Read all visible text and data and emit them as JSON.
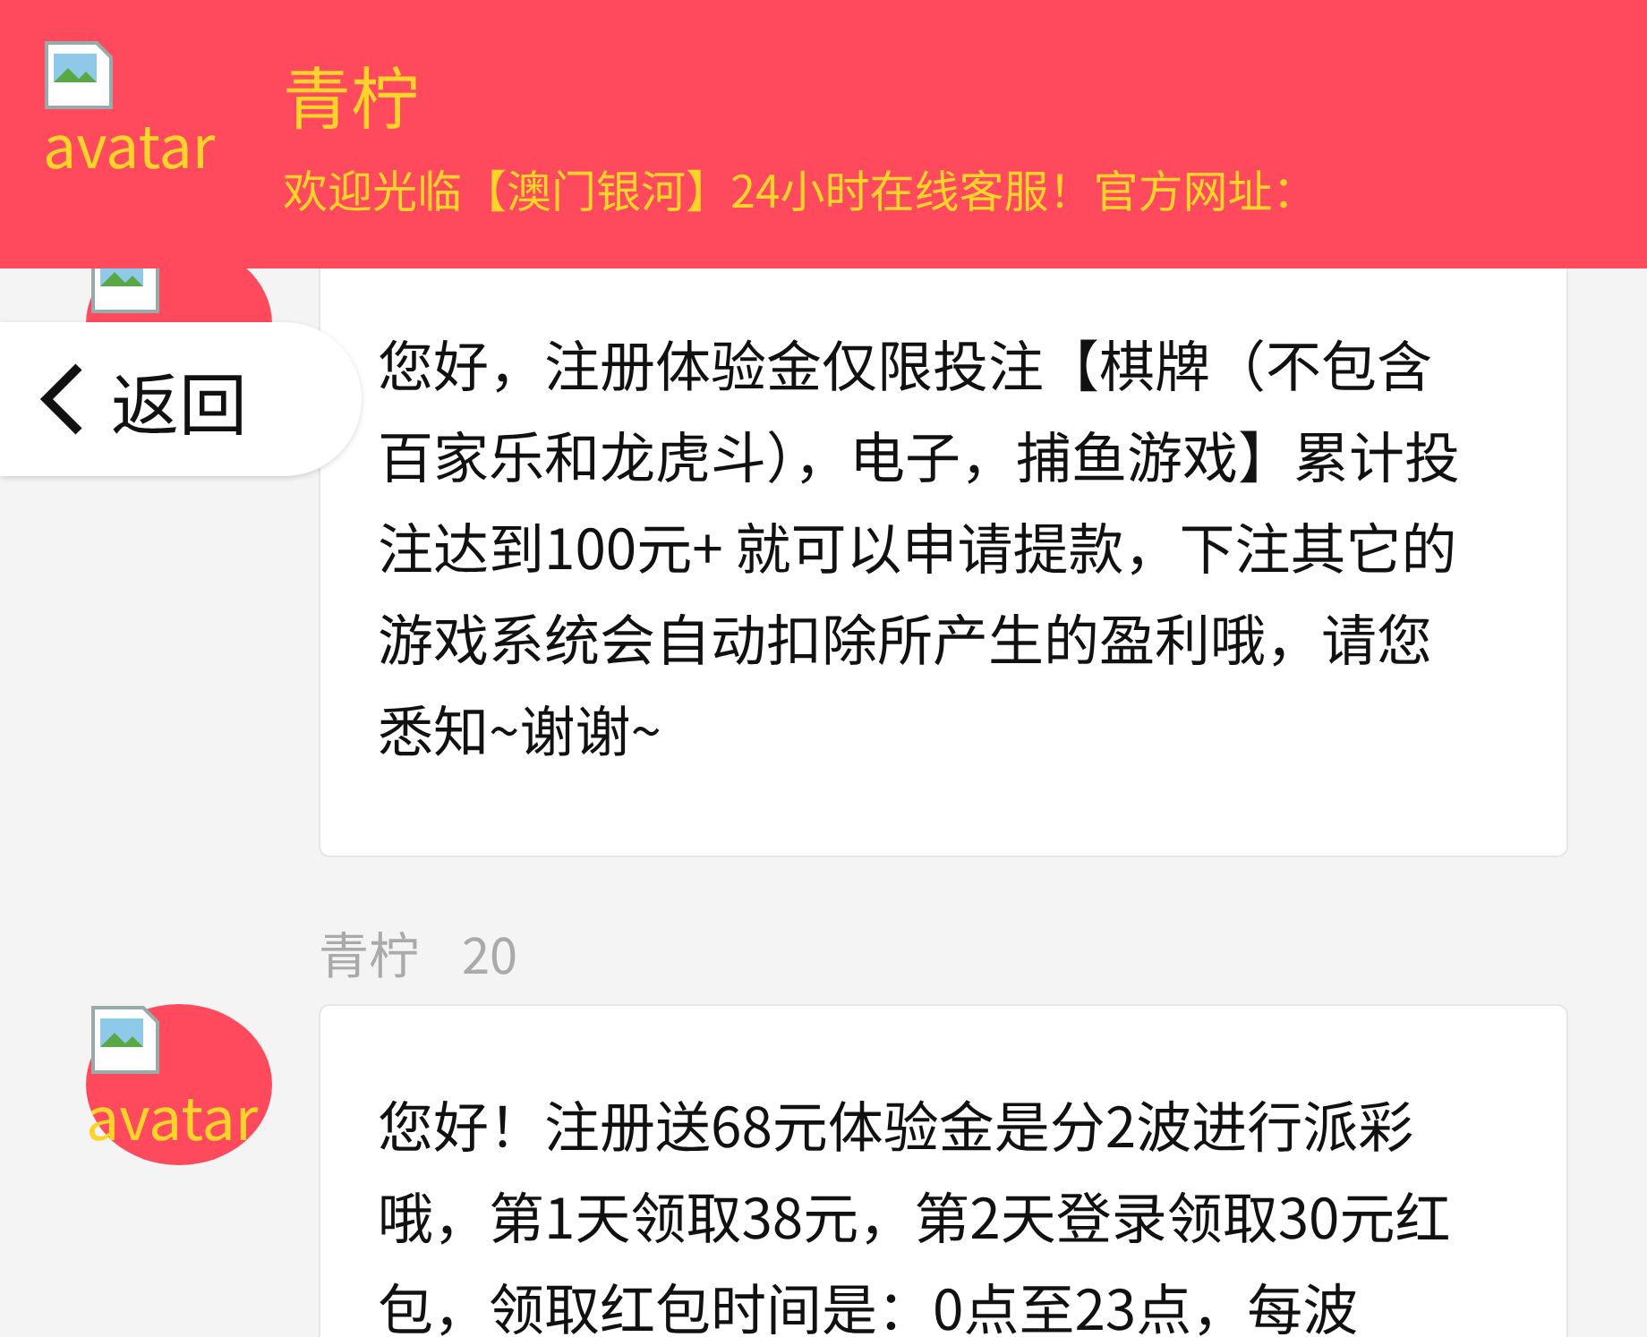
{
  "header": {
    "avatar_alt": "avatar",
    "name": "青柠",
    "marquee": "欢迎光临【澳门银河】24小时在线客服！官方网址："
  },
  "back_button": {
    "label": "返回"
  },
  "messages": [
    {
      "text": "您好，注册体验金仅限投注【棋牌（不包含百家乐和龙虎斗），电子，捕鱼游戏】累计投注达到100元+ 就可以申请提款，下注其它的游戏系统会自动扣除所产生的盈利哦，请您悉知~谢谢~"
    },
    {
      "sender": "青柠",
      "time": "20",
      "avatar_alt": "avatar",
      "text": "您好！注册送68元体验金是分2波进行派彩哦，第1天领取38元，第2天登录领取30元红包，领取红包时间是：0点至23点，每波"
    }
  ]
}
